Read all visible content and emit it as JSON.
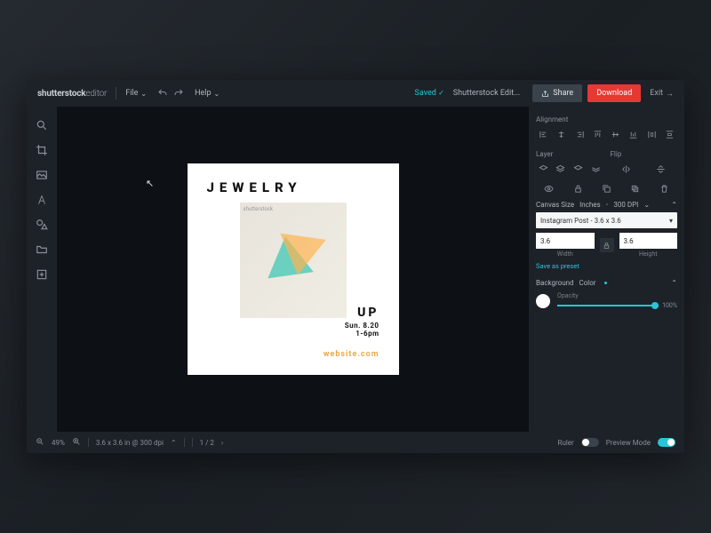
{
  "brand": {
    "name": "shutterstock",
    "suffix": "editor"
  },
  "topbar": {
    "file": "File",
    "help": "Help",
    "saved": "Saved",
    "doc_title": "Shutterstock Edit...",
    "share": "Share",
    "download": "Download",
    "exit": "Exit"
  },
  "left_tools": [
    "search",
    "crop",
    "image",
    "text",
    "shapes",
    "folder",
    "upload"
  ],
  "canvas": {
    "title": "JEWELRY",
    "up": "UP",
    "date": "Sun. 8.20",
    "time": "1-6pm",
    "site": "website.com",
    "watermark": "shutterstock"
  },
  "right": {
    "alignment_label": "Alignment",
    "layer_label": "Layer",
    "flip_label": "Flip",
    "canvas_size_label": "Canvas Size",
    "unit": "Inches",
    "dpi": "300  DPI",
    "preset": "Instagram Post - 3.6 x 3.6",
    "width": "3.6",
    "height": "3.6",
    "width_label": "Width",
    "height_label": "Height",
    "save_preset": "Save as preset",
    "background_label": "Background",
    "background_mode": "Color",
    "opacity_label": "Opacity",
    "opacity_value": "100%"
  },
  "bottom": {
    "zoom": "49%",
    "dims": "3.6 x 3.6 in @ 300 dpi",
    "page": "1 / 2",
    "ruler_label": "Ruler",
    "preview_label": "Preview Mode"
  }
}
